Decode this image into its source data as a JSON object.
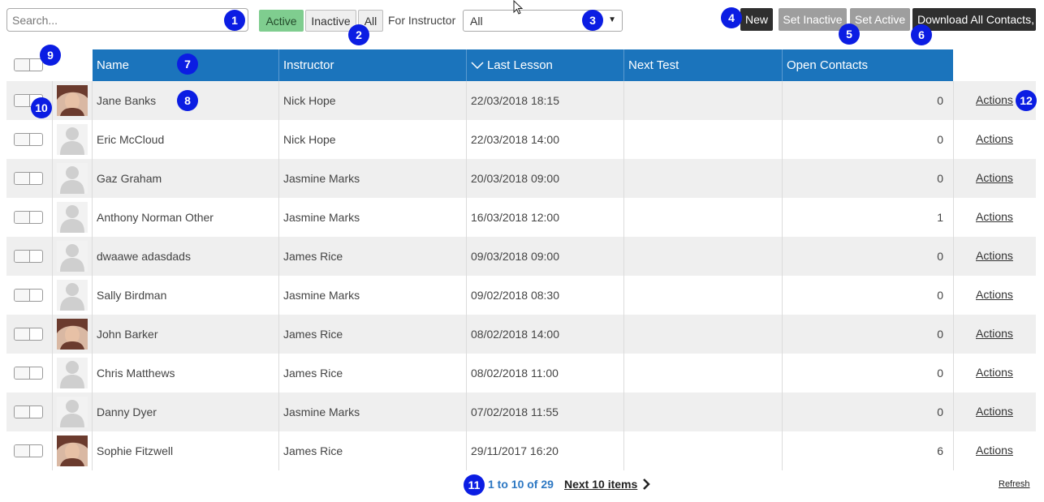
{
  "toolbar": {
    "search_placeholder": "Search...",
    "filters": [
      "Active",
      "Inactive",
      "All"
    ],
    "for_instructor_label": "For Instructor",
    "instructor_select_value": "All",
    "new_label": "New",
    "set_inactive_label": "Set Inactive",
    "set_active_label": "Set Active",
    "download_label": "Download All Contacts,"
  },
  "table": {
    "columns": {
      "name": "Name",
      "instructor": "Instructor",
      "last_lesson": "Last Lesson",
      "next_test": "Next Test",
      "open_contacts": "Open Contacts"
    },
    "rows": [
      {
        "name": "Jane Banks",
        "instructor": "Nick Hope",
        "last_lesson": "22/03/2018 18:15",
        "next_test": "",
        "open_contacts": "0",
        "actions": "Actions",
        "avatar": "photo"
      },
      {
        "name": "Eric McCloud",
        "instructor": "Nick Hope",
        "last_lesson": "22/03/2018 14:00",
        "next_test": "",
        "open_contacts": "0",
        "actions": "Actions",
        "avatar": "silhouette"
      },
      {
        "name": "Gaz Graham",
        "instructor": "Jasmine Marks",
        "last_lesson": "20/03/2018 09:00",
        "next_test": "",
        "open_contacts": "0",
        "actions": "Actions",
        "avatar": "silhouette"
      },
      {
        "name": "Anthony Norman Other",
        "instructor": "Jasmine Marks",
        "last_lesson": "16/03/2018 12:00",
        "next_test": "",
        "open_contacts": "1",
        "actions": "Actions",
        "avatar": "silhouette"
      },
      {
        "name": "dwaawe adasdads",
        "instructor": "James Rice",
        "last_lesson": "09/03/2018 09:00",
        "next_test": "",
        "open_contacts": "0",
        "actions": "Actions",
        "avatar": "silhouette"
      },
      {
        "name": "Sally Birdman",
        "instructor": "Jasmine Marks",
        "last_lesson": "09/02/2018 08:30",
        "next_test": "",
        "open_contacts": "0",
        "actions": "Actions",
        "avatar": "silhouette"
      },
      {
        "name": "John Barker",
        "instructor": "James Rice",
        "last_lesson": "08/02/2018 14:00",
        "next_test": "",
        "open_contacts": "0",
        "actions": "Actions",
        "avatar": "photo"
      },
      {
        "name": "Chris Matthews",
        "instructor": "James Rice",
        "last_lesson": "08/02/2018 11:00",
        "next_test": "",
        "open_contacts": "0",
        "actions": "Actions",
        "avatar": "silhouette"
      },
      {
        "name": "Danny Dyer",
        "instructor": "Jasmine Marks",
        "last_lesson": "07/02/2018 11:55",
        "next_test": "",
        "open_contacts": "0",
        "actions": "Actions",
        "avatar": "silhouette"
      },
      {
        "name": "Sophie Fitzwell",
        "instructor": "James Rice",
        "last_lesson": "29/11/2017 16:20",
        "next_test": "",
        "open_contacts": "6",
        "actions": "Actions",
        "avatar": "photo"
      }
    ]
  },
  "pager": {
    "range": "1 to 10 of 29",
    "next_label": "Next 10 items",
    "refresh_label": "Refresh"
  },
  "badges": [
    "1",
    "2",
    "3",
    "4",
    "5",
    "6",
    "7",
    "8",
    "9",
    "10",
    "11",
    "12"
  ],
  "colors": {
    "header_bg": "#1b74bc",
    "active_filter": "#7fcd8f",
    "badge": "#0b1de3",
    "dark_button": "#2f2f2f",
    "grey_button": "#9e9e9e"
  }
}
